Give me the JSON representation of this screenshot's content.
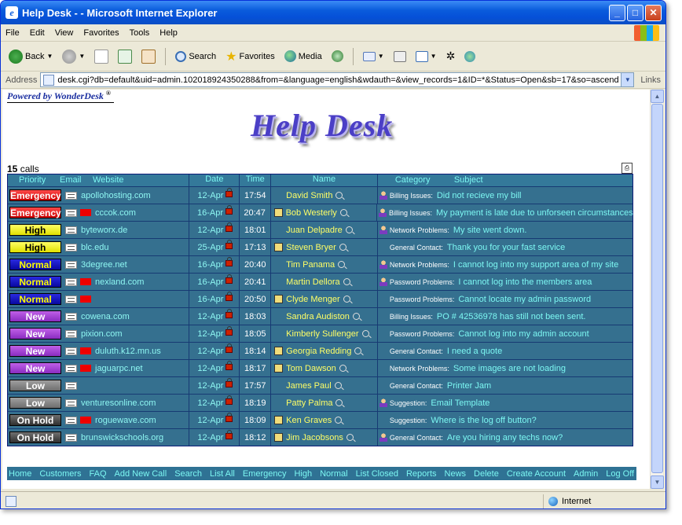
{
  "window": {
    "title": "Help Desk - - Microsoft Internet Explorer",
    "minimize": "_",
    "maximize": "□",
    "close": "✕"
  },
  "menu": [
    "File",
    "Edit",
    "View",
    "Favorites",
    "Tools",
    "Help"
  ],
  "toolbar": {
    "back": "Back",
    "search": "Search",
    "favorites": "Favorites",
    "media": "Media"
  },
  "address": {
    "label": "Address",
    "url": "desk.cgi?db=default&uid=admin.102018924350288&from=&language=english&wdauth=&view_records=1&ID=*&Status=Open&sb=17&so=ascend",
    "links": "Links"
  },
  "page": {
    "powered_by": "Powered by WonderDesk",
    "copyright": "®",
    "logo": "Help Desk",
    "count_number": "15",
    "count_label": "calls"
  },
  "table": {
    "headers": {
      "priority": "Priority",
      "email": "Email",
      "website": "Website",
      "date": "Date",
      "time": "Time",
      "name": "Name",
      "category": "Category",
      "subject": "Subject"
    },
    "rows": [
      {
        "priority": "Emergency",
        "pclass": "p-emergency",
        "flag": false,
        "website": "apollohosting.com",
        "date": "12-Apr",
        "time": "17:54",
        "note": false,
        "name": "David Smith",
        "person": true,
        "category": "Billing Issues:",
        "subject": "Did not recieve my bill"
      },
      {
        "priority": "Emergency",
        "pclass": "p-emergency",
        "flag": true,
        "website": "cccok.com",
        "date": "16-Apr",
        "time": "20:47",
        "note": true,
        "name": "Bob Westerly",
        "person": true,
        "category": "Billing Issues:",
        "subject": "My payment is late due to unforseen circumstances"
      },
      {
        "priority": "High",
        "pclass": "p-high",
        "flag": false,
        "website": "byteworx.de",
        "date": "12-Apr",
        "time": "18:01",
        "note": false,
        "name": "Juan Delpadre",
        "person": true,
        "category": "Network Problems:",
        "subject": "My site went down."
      },
      {
        "priority": "High",
        "pclass": "p-high",
        "flag": false,
        "website": "blc.edu",
        "date": "25-Apr",
        "time": "17:13",
        "note": true,
        "name": "Steven Bryer",
        "person": false,
        "category": "General Contact:",
        "subject": "Thank you for your fast service"
      },
      {
        "priority": "Normal",
        "pclass": "p-normal",
        "flag": false,
        "website": "3degree.net",
        "date": "16-Apr",
        "time": "20:40",
        "note": false,
        "name": "Tim Panama",
        "person": true,
        "category": "Network Problems:",
        "subject": "I cannot log into my support area of my site"
      },
      {
        "priority": "Normal",
        "pclass": "p-normal",
        "flag": true,
        "website": "nexland.com",
        "date": "16-Apr",
        "time": "20:41",
        "note": false,
        "name": "Martin Dellora",
        "person": true,
        "category": "Password Problems:",
        "subject": "I cannot log into the members area"
      },
      {
        "priority": "Normal",
        "pclass": "p-normal",
        "flag": true,
        "website": "",
        "date": "16-Apr",
        "time": "20:50",
        "note": true,
        "name": "Clyde Menger",
        "person": false,
        "category": "Password Problems:",
        "subject": "Cannot locate my admin password"
      },
      {
        "priority": "New",
        "pclass": "p-new",
        "flag": false,
        "website": "cowena.com",
        "date": "12-Apr",
        "time": "18:03",
        "note": false,
        "name": "Sandra Audiston",
        "person": false,
        "category": "Billing Issues:",
        "subject": "PO # 42536978 has still not been sent."
      },
      {
        "priority": "New",
        "pclass": "p-new",
        "flag": false,
        "website": "pixion.com",
        "date": "12-Apr",
        "time": "18:05",
        "note": false,
        "name": "Kimberly Sullenger",
        "person": false,
        "category": "Password Problems:",
        "subject": "Cannot log into my admin account"
      },
      {
        "priority": "New",
        "pclass": "p-new",
        "flag": true,
        "website": "duluth.k12.mn.us",
        "date": "12-Apr",
        "time": "18:14",
        "note": true,
        "name": "Georgia Redding",
        "person": false,
        "category": "General Contact:",
        "subject": "I need a quote"
      },
      {
        "priority": "New",
        "pclass": "p-new",
        "flag": true,
        "website": "jaguarpc.net",
        "date": "12-Apr",
        "time": "18:17",
        "note": true,
        "name": "Tom Dawson",
        "person": false,
        "category": "Network Problems:",
        "subject": "Some images are not loading"
      },
      {
        "priority": "Low",
        "pclass": "p-low",
        "flag": false,
        "website": "",
        "date": "12-Apr",
        "time": "17:57",
        "note": false,
        "name": "James Paul",
        "person": false,
        "category": "General Contact:",
        "subject": "Printer Jam"
      },
      {
        "priority": "Low",
        "pclass": "p-low",
        "flag": false,
        "website": "venturesonline.com",
        "date": "12-Apr",
        "time": "18:19",
        "note": false,
        "name": "Patty Palma",
        "person": true,
        "category": "Suggestion:",
        "subject": "Email Template"
      },
      {
        "priority": "On Hold",
        "pclass": "p-onhold",
        "flag": true,
        "website": "roguewave.com",
        "date": "12-Apr",
        "time": "18:09",
        "note": true,
        "name": "Ken Graves",
        "person": false,
        "category": "Suggestion:",
        "subject": "Where is the log off button?"
      },
      {
        "priority": "On Hold",
        "pclass": "p-onhold",
        "flag": false,
        "website": "brunswickschools.org",
        "date": "12-Apr",
        "time": "18:12",
        "note": true,
        "name": "Jim Jacobsons",
        "person": true,
        "category": "General Contact:",
        "subject": "Are you hiring any techs now?"
      }
    ]
  },
  "footer": [
    "Home",
    "Customers",
    "FAQ",
    "Add New Call",
    "Search",
    "List All",
    "Emergency",
    "High",
    "Normal",
    "List Closed",
    "Reports",
    "News",
    "Delete",
    "Create Account",
    "Admin",
    "Log Off"
  ],
  "status": {
    "zone": "Internet"
  }
}
